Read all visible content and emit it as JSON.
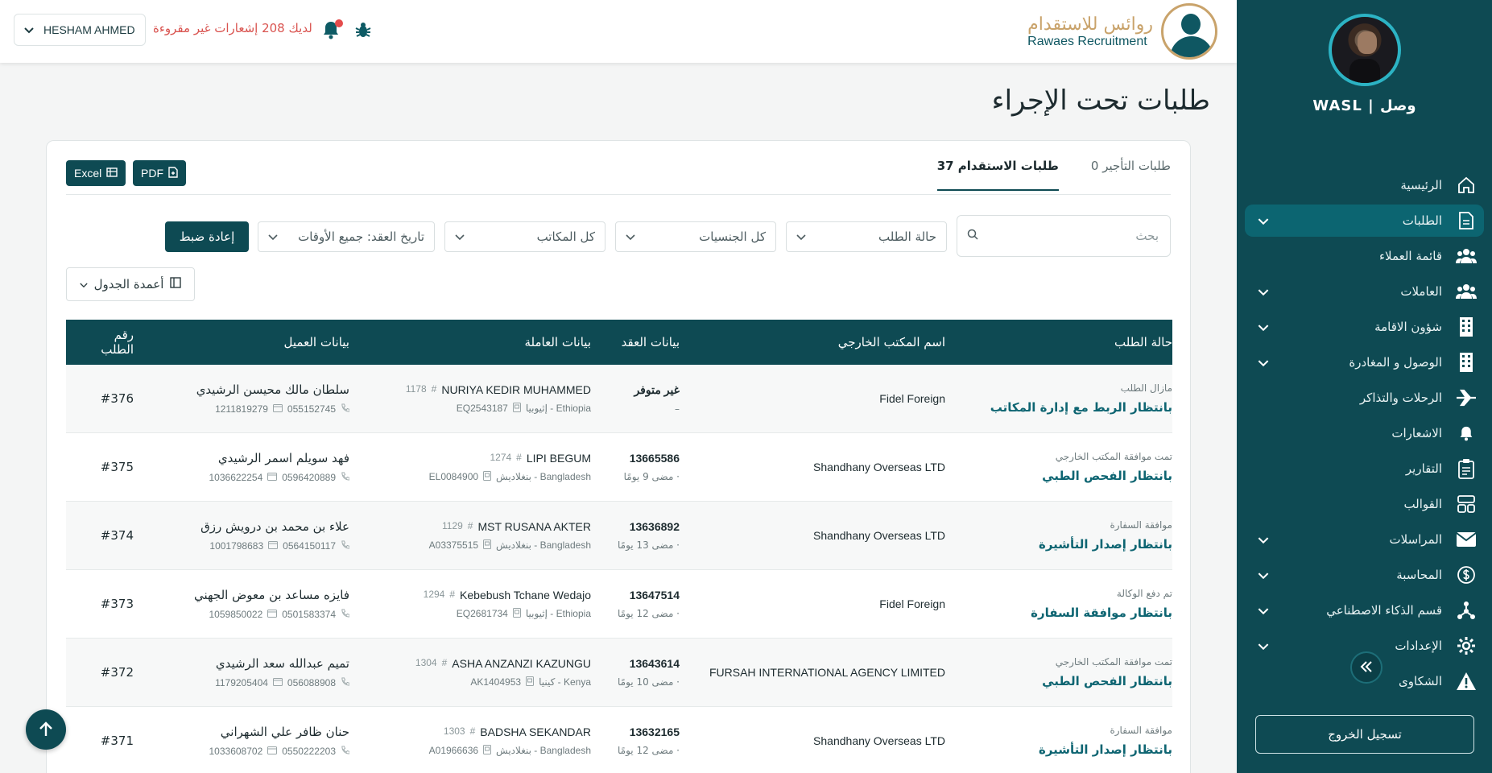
{
  "app": {
    "brand": "WASL | وصل",
    "logo_ar": "روائس للاستقدام",
    "logo_en": "Rawaes Recruitment"
  },
  "topbar": {
    "user": "HESHAM AHMED",
    "notifications": "لديك 208 إشعارات غير مقروءة"
  },
  "sidebar": {
    "items": [
      {
        "label": "الرئيسية",
        "icon": "home-icon",
        "chevron": false,
        "active": false
      },
      {
        "label": "الطلبات",
        "icon": "document-icon",
        "chevron": true,
        "active": true
      },
      {
        "label": "قائمة العملاء",
        "icon": "users-icon",
        "chevron": false,
        "active": false
      },
      {
        "label": "العاملات",
        "icon": "users-icon",
        "chevron": true,
        "active": false
      },
      {
        "label": "شؤون الاقامة",
        "icon": "building-icon",
        "chevron": true,
        "active": false
      },
      {
        "label": "الوصول و المغادرة",
        "icon": "building-icon",
        "chevron": true,
        "active": false
      },
      {
        "label": "الرحلات والتذاكر",
        "icon": "plane-icon",
        "chevron": false,
        "active": false
      },
      {
        "label": "الاشعارات",
        "icon": "bell-icon",
        "chevron": false,
        "active": false
      },
      {
        "label": "التقارير",
        "icon": "clipboard-icon",
        "chevron": false,
        "active": false
      },
      {
        "label": "القوالب",
        "icon": "templates-icon",
        "chevron": false,
        "active": false
      },
      {
        "label": "المراسلات",
        "icon": "mail-icon",
        "chevron": true,
        "active": false
      },
      {
        "label": "المحاسبة",
        "icon": "dollar-icon",
        "chevron": true,
        "active": false
      },
      {
        "label": "قسم الذكاء الاصطناعي",
        "icon": "ai-icon",
        "chevron": true,
        "active": false
      },
      {
        "label": "الإعدادات",
        "icon": "gear-icon",
        "chevron": true,
        "active": false
      },
      {
        "label": "الشكاوى",
        "icon": "warning-icon",
        "chevron": false,
        "active": false
      }
    ],
    "logout": "تسجيل الخروج"
  },
  "page": {
    "title": "طلبات تحت الإجراء"
  },
  "tabs": [
    {
      "label": "طلبات الاستقدام 37",
      "active": true
    },
    {
      "label": "طلبات التأجير 0",
      "active": false
    }
  ],
  "exports": {
    "pdf": "PDF",
    "excel": "Excel"
  },
  "filters": {
    "search_placeholder": "بحث",
    "status": "حالة الطلب",
    "nationality": "كل الجنسيات",
    "offices": "كل المكاتب",
    "date": "تاريخ العقد: جميع الأوقات",
    "reset": "إعادة ضبط",
    "columns": "أعمدة الجدول"
  },
  "table": {
    "headers": [
      "رقم الطلب",
      "بيانات العميل",
      "بيانات العاملة",
      "بيانات العقد",
      "اسم المكتب الخارجي",
      "حالة الطلب"
    ],
    "rows": [
      {
        "no": "#376",
        "customer": "سلطان مالك محيسن الرشيدي",
        "phone": "055152745",
        "id": "1211819279",
        "worker": "NURIYA KEDIR MUHAMMED",
        "worker_no": "1178",
        "country": "Ethiopia - إثيوبيا",
        "passport": "EQ2543187",
        "contract": "غير متوفر",
        "contract_sub": "–",
        "office": "Fidel Foreign",
        "status_small": "مازال الطلب",
        "status": "بانتظار الربط مع إدارة المكاتب"
      },
      {
        "no": "#375",
        "customer": "فهد سويلم اسمر الرشيدي",
        "phone": "0596420889",
        "id": "1036622254",
        "worker": "LIPI BEGUM",
        "worker_no": "1274",
        "country": "Bangladesh - بنغلاديش",
        "passport": "EL0084900",
        "contract": "13665586",
        "contract_sub": "· مضى 9 يومًا",
        "office": "Shandhany Overseas LTD",
        "status_small": "تمت موافقة المكتب الخارجي",
        "status": "بانتظار الفحص الطبي"
      },
      {
        "no": "#374",
        "customer": "علاء بن محمد بن درويش رزق",
        "phone": "0564150117",
        "id": "1001798683",
        "worker": "MST RUSANA AKTER",
        "worker_no": "1129",
        "country": "Bangladesh - بنغلاديش",
        "passport": "A03375515",
        "contract": "13636892",
        "contract_sub": "· مضى 13 يومًا",
        "office": "Shandhany Overseas LTD",
        "status_small": "موافقة السفارة",
        "status": "بانتظار إصدار التأشيرة"
      },
      {
        "no": "#373",
        "customer": "فايزه مساعد بن معوض الجهني",
        "phone": "0501583374",
        "id": "1059850022",
        "worker": "Kebebush Tchane Wedajo",
        "worker_no": "1294",
        "country": "Ethiopia - إثيوبيا",
        "passport": "EQ2681734",
        "contract": "13647514",
        "contract_sub": "· مضى 12 يومًا",
        "office": "Fidel Foreign",
        "status_small": "تم دفع الوكالة",
        "status": "بانتظار موافقة السفارة"
      },
      {
        "no": "#372",
        "customer": "تميم عبدالله سعد الرشيدي",
        "phone": "056088908",
        "id": "1179205404",
        "worker": "ASHA ANZANZI KAZUNGU",
        "worker_no": "1304",
        "country": "Kenya - كينيا",
        "passport": "AK1404953",
        "contract": "13643614",
        "contract_sub": "· مضى 10 يومًا",
        "office": "FURSAH INTERNATIONAL AGENCY LIMITED",
        "status_small": "تمت موافقة المكتب الخارجي",
        "status": "بانتظار الفحص الطبي"
      },
      {
        "no": "#371",
        "customer": "حنان ظافر علي الشهراني",
        "phone": "0550222203",
        "id": "1033608702",
        "worker": "BADSHA SEKANDAR",
        "worker_no": "1303",
        "country": "Bangladesh - بنغلاديش",
        "passport": "A01966636",
        "contract": "13632165",
        "contract_sub": "· مضى 12 يومًا",
        "office": "Shandhany Overseas LTD",
        "status_small": "موافقة السفارة",
        "status": "بانتظار إصدار التأشيرة"
      }
    ]
  },
  "colors": {
    "primary": "#0e4a53",
    "accent": "#0e6572",
    "gold": "#c9a36b",
    "alert": "#d9534f"
  }
}
